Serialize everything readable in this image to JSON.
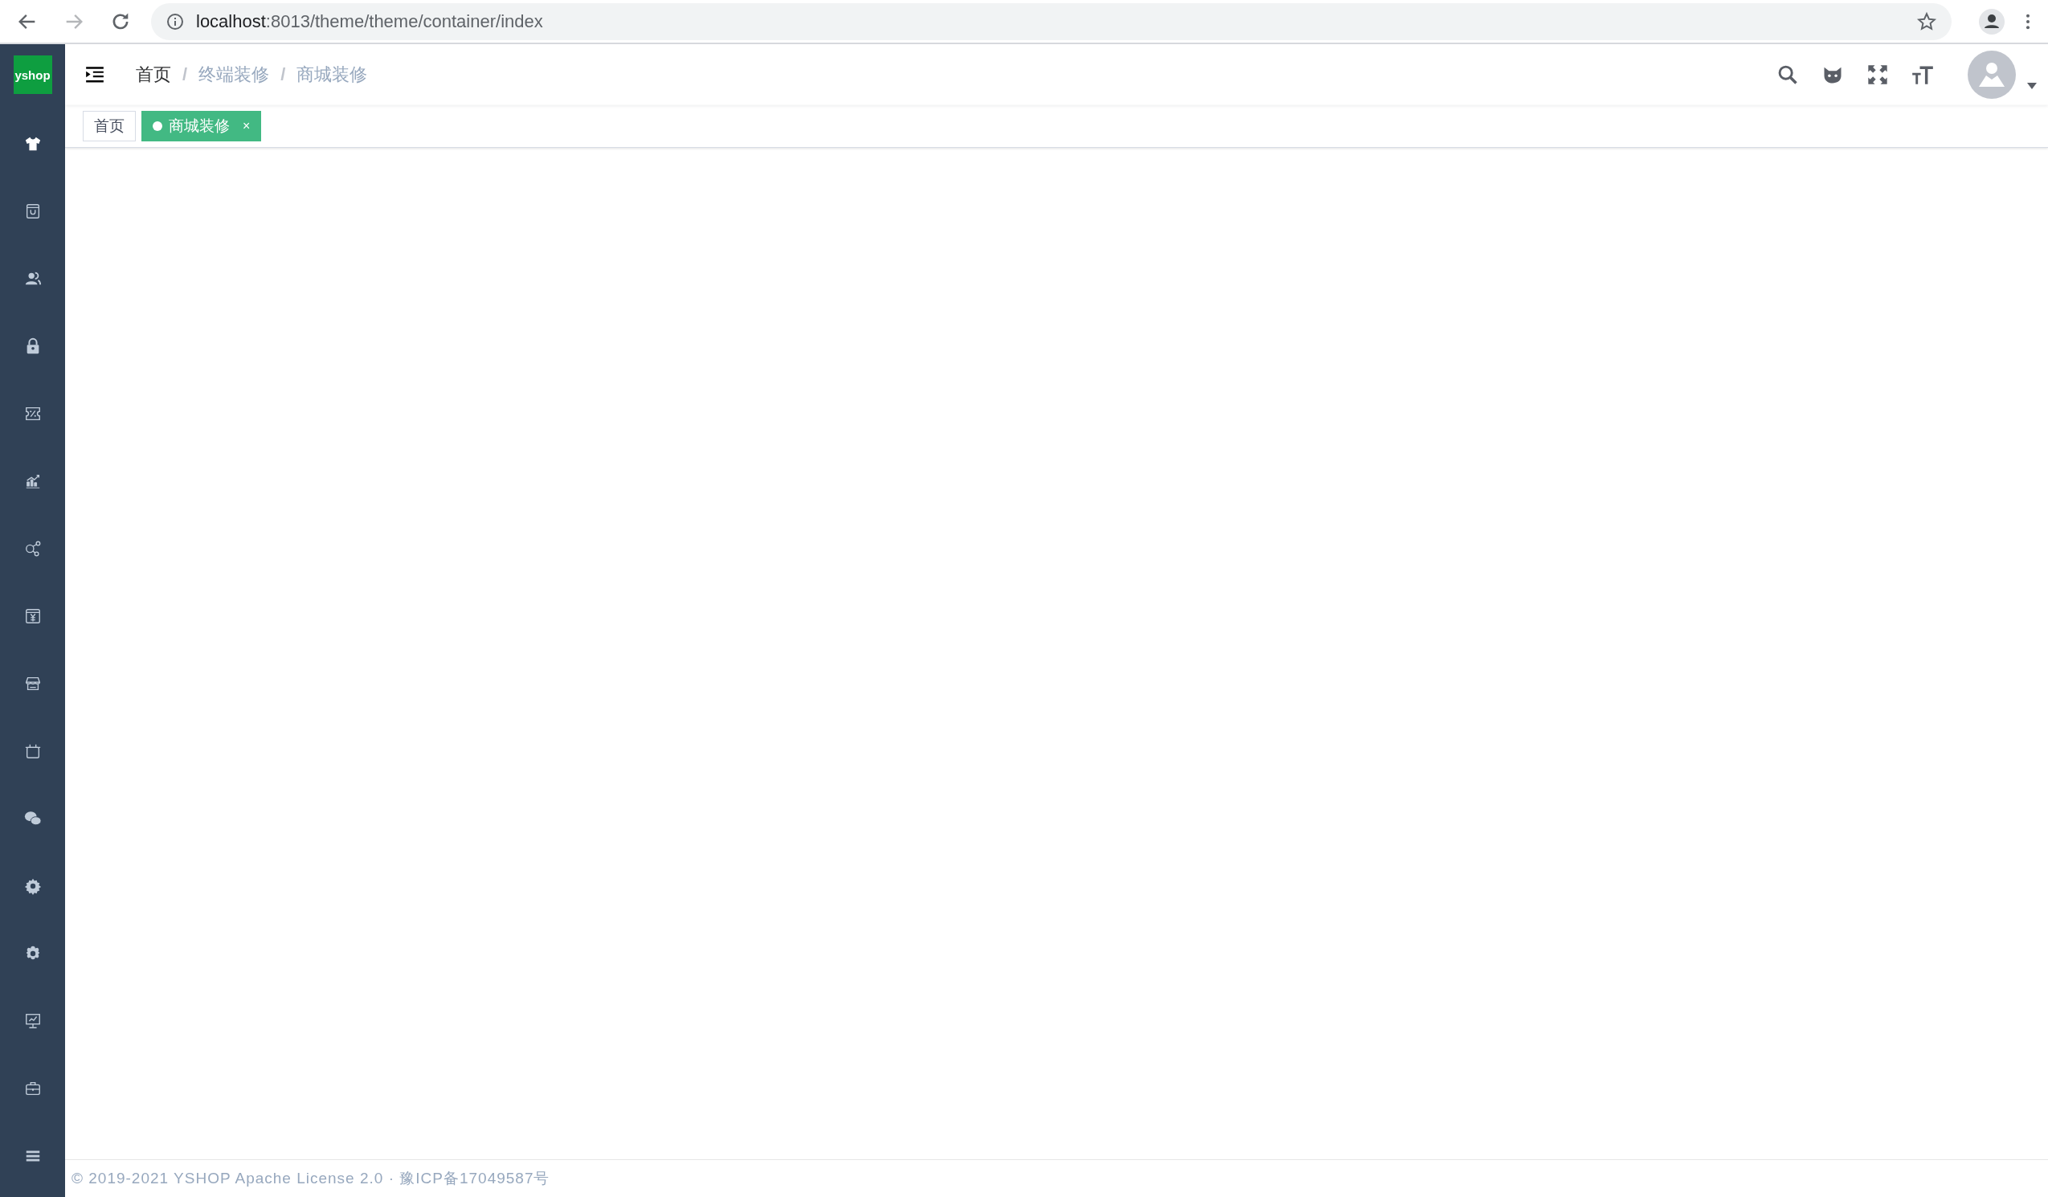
{
  "browser": {
    "url_host": "localhost",
    "url_rest": ":8013/theme/theme/container/index"
  },
  "logo": {
    "text": "yshop"
  },
  "sidebar": {
    "items": [
      {
        "selected": true
      },
      {
        "selected": false
      },
      {
        "selected": false
      },
      {
        "selected": false
      },
      {
        "selected": false
      },
      {
        "selected": false
      },
      {
        "selected": false
      },
      {
        "selected": false
      },
      {
        "selected": false
      },
      {
        "selected": false
      },
      {
        "selected": false
      },
      {
        "selected": false
      },
      {
        "selected": false
      },
      {
        "selected": false
      },
      {
        "selected": false
      },
      {
        "selected": false
      }
    ]
  },
  "breadcrumb": [
    {
      "label": "首页",
      "disabled": false
    },
    {
      "label": "终端装修",
      "disabled": true
    },
    {
      "label": "商城装修",
      "disabled": true
    }
  ],
  "breadcrumb_separator": "/",
  "tags": [
    {
      "label": "首页",
      "selected": false,
      "closable": false
    },
    {
      "label": "商城装修",
      "selected": true,
      "closable": true
    }
  ],
  "tag_close": "×",
  "footer": "© 2019-2021 YSHOP Apache License 2.0 · 豫ICP备17049587号"
}
